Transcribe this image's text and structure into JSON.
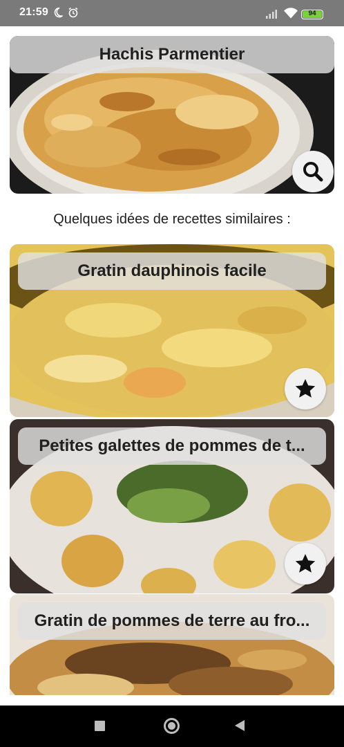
{
  "status_bar": {
    "time": "21:59",
    "battery": "94",
    "icons": [
      "moon-icon",
      "alarm-icon",
      "signal-icon",
      "wifi-icon",
      "battery-icon"
    ]
  },
  "main_recipe": {
    "title": "Hachis Parmentier",
    "action_icon": "search-icon"
  },
  "similar_section": {
    "heading": "Quelques idées de recettes similaires :"
  },
  "similar_recipes": [
    {
      "title": "Gratin dauphinois facile",
      "action_icon": "star-icon"
    },
    {
      "title": "Petites galettes de pommes de t...",
      "action_icon": "star-icon"
    },
    {
      "title": "Gratin de pommes de terre au fro...",
      "action_icon": null
    }
  ],
  "nav_bar": {
    "icons": [
      "recents-square-icon",
      "home-circle-icon",
      "back-triangle-icon"
    ]
  },
  "colors": {
    "status_bar": "#7a7a7a",
    "title_overlay": "#e1e1e1",
    "button_bg": "#f1f1f1",
    "nav_bar": "#000000",
    "battery_fill": "#7bd03b"
  }
}
